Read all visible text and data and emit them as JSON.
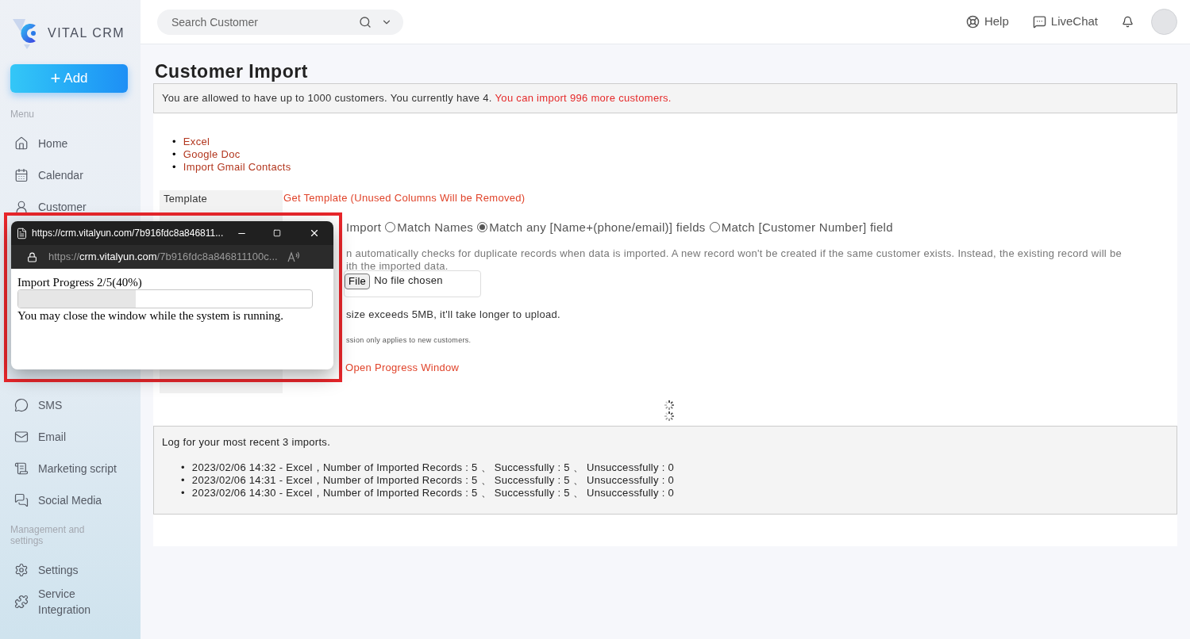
{
  "brand": {
    "name": "VITAL CRM"
  },
  "add_button": {
    "label": "Add",
    "icon": "+"
  },
  "sidebar": {
    "sections": [
      {
        "heading": "Menu",
        "items": [
          {
            "label": "Home",
            "kind": "home"
          },
          {
            "label": "Calendar",
            "kind": "calendar"
          },
          {
            "label": "Customer",
            "kind": "customer"
          }
        ]
      },
      {
        "items": [
          {
            "label": "SMS",
            "kind": "sms"
          },
          {
            "label": "Email",
            "kind": "email"
          },
          {
            "label": "Marketing script",
            "kind": "script"
          },
          {
            "label": "Social Media",
            "kind": "social"
          }
        ]
      },
      {
        "heading": "Management and settings",
        "items": [
          {
            "label": "Settings",
            "kind": "settings"
          },
          {
            "label": "Service Integration",
            "kind": "integration"
          }
        ]
      }
    ]
  },
  "list_marker": "•",
  "search": {
    "placeholder": "Search Customer"
  },
  "header_links": [
    {
      "label": "Help",
      "kind": "help"
    },
    {
      "label": "LiveChat",
      "kind": "chat"
    }
  ],
  "page": {
    "title": "Customer Import",
    "quota": {
      "text": "You are allowed to have up to 1000 customers. You currently have 4.",
      "highlight": "You can import 996 more customers."
    },
    "sources": [
      "Excel",
      "Google Doc",
      "Import Gmail Contacts"
    ],
    "template": {
      "label": "Template",
      "link": "Get Template (Unused Columns Will be Removed)"
    },
    "rules": {
      "fragment": "Import",
      "options": [
        {
          "label": "Match Names",
          "selected": false
        },
        {
          "label": "Match any [Name+(phone/email)] fields",
          "selected": true
        },
        {
          "label": "Match [Customer Number] field",
          "selected": false
        }
      ]
    },
    "description_lines": [
      "n automatically checks for duplicate records when data is imported. A new record won't be created if the same customer exists. Instead, the existing record will be",
      "ith the imported data."
    ],
    "file": {
      "button": "File",
      "status": "No file chosen"
    },
    "size_note": "size exceeds 5MB, it'll take longer to upload.",
    "permission_note": "ssion only applies to new customers.",
    "progress_link": "Open Progress Window"
  },
  "log": {
    "heading": "Log for your most recent 3 imports.",
    "entries": [
      "2023/02/06 14:32 - Excel，Number of Imported Records : 5 、 Successfully : 5 、 Unsuccessfully : 0",
      "2023/02/06 14:31 - Excel，Number of Imported Records : 5 、 Successfully : 5 、 Unsuccessfully : 0",
      "2023/02/06 14:30 - Excel，Number of Imported Records : 5 、 Successfully : 5 、 Unsuccessfully : 0"
    ]
  },
  "popup": {
    "title": "https://crm.vitalyun.com/7b916fdc8a846811...",
    "address": {
      "scheme": "https://",
      "host": "crm.vitalyun.com",
      "path": "/7b916fdc8a846811100c..."
    },
    "progress_label": "Import Progress 2/5(40%)",
    "level": 0.4,
    "note": "You may close the window while the system is running."
  }
}
